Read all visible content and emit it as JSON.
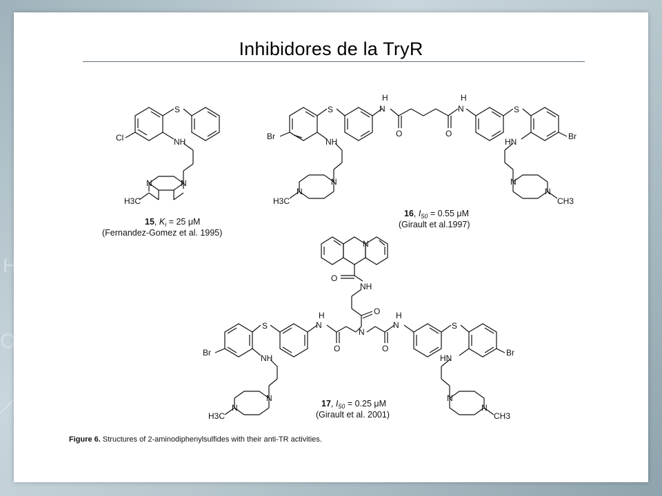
{
  "slide": {
    "title": "Inhibidores de la TryR"
  },
  "compounds": [
    {
      "number": "15",
      "measure": "K",
      "measure_sub": "i",
      "value": "= 25 μM",
      "reference": "(Fernandez-Gomez et al. 1995)"
    },
    {
      "number": "16",
      "measure": "I",
      "measure_sub": "50",
      "value": "= 0.55 μM",
      "reference": "(Girault et al.1997)"
    },
    {
      "number": "17",
      "measure": "I",
      "measure_sub": "50",
      "value": "= 0.25 μM",
      "reference": "(Girault et al. 2001)"
    }
  ],
  "atom_labels": {
    "S": "S",
    "NH": "NH",
    "HN": "HN",
    "N": "N",
    "H": "H",
    "O": "O",
    "Cl": "Cl",
    "Br": "Br",
    "H3C": "H3C",
    "CH3": "CH3"
  },
  "figure_caption": {
    "label": "Figure 6.",
    "text": "Structures of 2-aminodiphenylsulfides with their anti-TR activities."
  }
}
